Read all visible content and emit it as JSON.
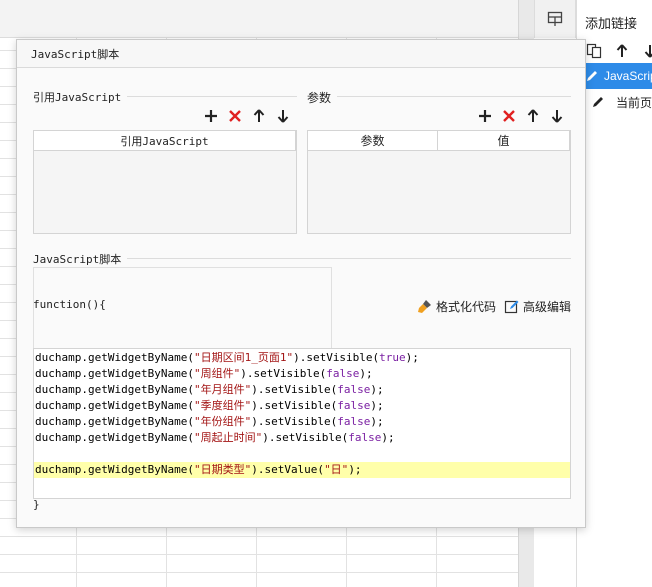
{
  "right_panel": {
    "title": "添加链接",
    "items": [
      {
        "label": "JavaScript",
        "selected": true
      },
      {
        "label": "当前页",
        "selected": false
      }
    ]
  },
  "dialog": {
    "title": "JavaScript脚本",
    "ref_js": {
      "label": "引用JavaScript",
      "columns": [
        "引用JavaScript"
      ]
    },
    "params": {
      "label": "参数",
      "columns": [
        "参数",
        "值"
      ]
    },
    "script": {
      "label": "JavaScript脚本",
      "function_open": "function(){",
      "function_close": "}",
      "format_label": "格式化代码",
      "advanced_label": "高级编辑",
      "lines": [
        {
          "obj": "duchamp.getWidgetByName(",
          "arg": "\"日期区间1_页面1\"",
          "mid": ").setVisible(",
          "val": "true",
          "end": ");"
        },
        {
          "obj": "duchamp.getWidgetByName(",
          "arg": "\"周组件\"",
          "mid": ").setVisible(",
          "val": "false",
          "end": ");"
        },
        {
          "obj": "duchamp.getWidgetByName(",
          "arg": "\"年月组件\"",
          "mid": ").setVisible(",
          "val": "false",
          "end": ");"
        },
        {
          "obj": "duchamp.getWidgetByName(",
          "arg": "\"季度组件\"",
          "mid": ").setVisible(",
          "val": "false",
          "end": ");"
        },
        {
          "obj": "duchamp.getWidgetByName(",
          "arg": "\"年份组件\"",
          "mid": ").setVisible(",
          "val": "false",
          "end": ");"
        },
        {
          "obj": "duchamp.getWidgetByName(",
          "arg": "\"周起止时间\"",
          "mid": ").setVisible(",
          "val": "false",
          "end": ");"
        },
        {
          "obj": "",
          "arg": "",
          "mid": "",
          "val": "",
          "end": ""
        },
        {
          "obj": "duchamp.getWidgetByName(",
          "arg": "\"日期类型\"",
          "mid": ").setValue(",
          "val": "\"日\"",
          "end": ");"
        }
      ],
      "highlighted_line": 7
    }
  },
  "colors": {
    "delete_red": "#e02020",
    "selected_blue": "#2e8be8",
    "highlight_line": "#ffffaa"
  }
}
